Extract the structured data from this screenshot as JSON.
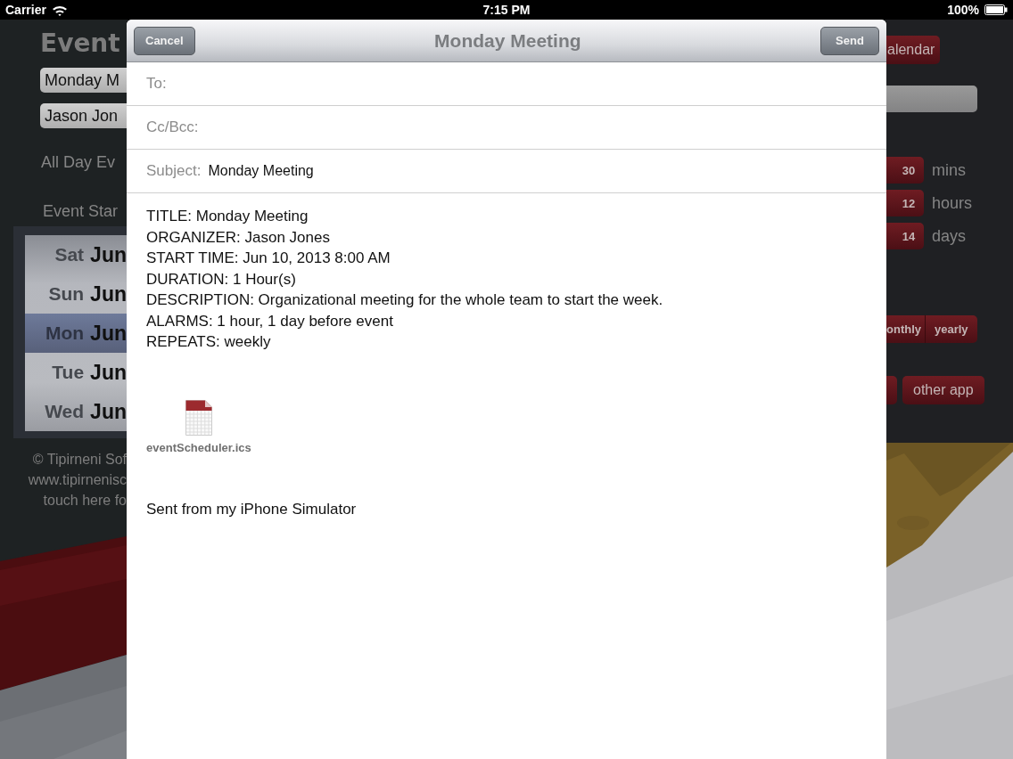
{
  "status_bar": {
    "carrier": "Carrier",
    "time": "7:15 PM",
    "battery": "100%"
  },
  "background_app": {
    "left": {
      "logo": "Event",
      "fields": [
        "Monday M",
        "Jason Jon"
      ],
      "labels": [
        "All Day Ev",
        "Event Star"
      ],
      "picker_rows": [
        {
          "day": "Sat",
          "month": "Jun",
          "selected": false
        },
        {
          "day": "Sun",
          "month": "Jun",
          "selected": false
        },
        {
          "day": "Mon",
          "month": "Jun",
          "selected": true
        },
        {
          "day": "Tue",
          "month": "Jun",
          "selected": false
        },
        {
          "day": "Wed",
          "month": "Jun",
          "selected": false
        }
      ],
      "footer": [
        "© Tipirneni Sof",
        "www.tipirnenisc",
        "touch here fo"
      ],
      "picture": {
        "kind": "picture"
      }
    },
    "right": {
      "calendar_button": "alendar",
      "alarm_rows": [
        {
          "value": "30",
          "unit": "mins"
        },
        {
          "value": "12",
          "unit": "hours"
        },
        {
          "value": "14",
          "unit": "days"
        }
      ],
      "repeat_segments": [
        "onthly",
        "yearly"
      ],
      "other_app_button": "other app",
      "picture": {
        "kind": "picture"
      }
    }
  },
  "mail": {
    "cancel": "Cancel",
    "title": "Monday Meeting",
    "send": "Send",
    "fields": [
      {
        "label": "To:"
      },
      {
        "label": "Cc/Bcc:"
      },
      {
        "label": "Subject:",
        "value": "Monday Meeting"
      }
    ],
    "body_lines": [
      "TITLE: Monday Meeting",
      "ORGANIZER: Jason Jones",
      "START TIME: Jun 10, 2013 8:00 AM",
      "DURATION: 1 Hour(s)",
      "DESCRIPTION: Organizational meeting for the whole team to start the week.",
      "ALARMS: 1 hour, 1 day before event",
      "REPEATS: weekly"
    ],
    "attachment": {
      "filename": "eventScheduler.ics"
    },
    "signature": "Sent from my iPhone Simulator"
  }
}
